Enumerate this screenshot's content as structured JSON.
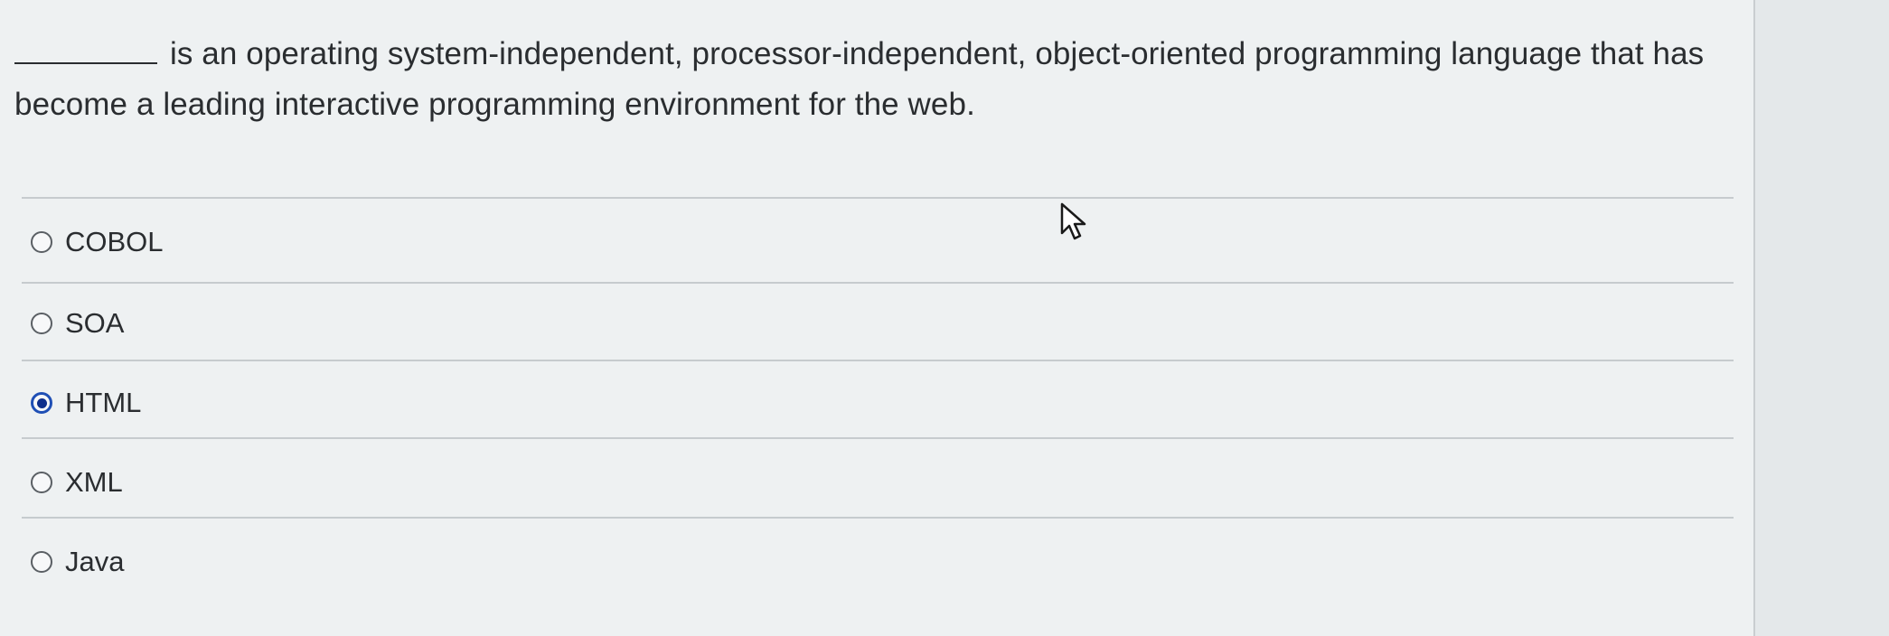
{
  "question": {
    "blank": "________",
    "text": "is an operating system-independent, processor-independent, object-oriented programming language that has become a leading interactive programming environment for the web."
  },
  "options": [
    {
      "label": "COBOL",
      "selected": false
    },
    {
      "label": "SOA",
      "selected": false
    },
    {
      "label": "HTML",
      "selected": true
    },
    {
      "label": "XML",
      "selected": false
    },
    {
      "label": "Java",
      "selected": false
    }
  ],
  "cursor_icon": "arrow-pointer-icon",
  "colors": {
    "background": "#eef1f2",
    "text": "#2a2d30",
    "divider": "#c6cbce",
    "radio_selected": "#1f4fb5"
  }
}
